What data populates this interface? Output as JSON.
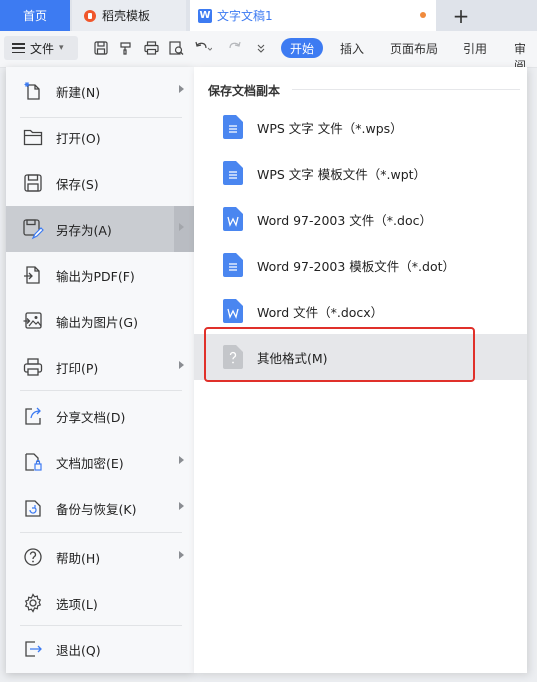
{
  "tabs": {
    "home": "首页",
    "templates": "稻壳模板",
    "document": "文字文稿1"
  },
  "toolbar": {
    "file_menu_label": "文件",
    "ribbon_tabs": [
      "开始",
      "插入",
      "页面布局",
      "引用",
      "审阅"
    ]
  },
  "file_menu": {
    "items": [
      {
        "label": "新建(N)",
        "icon": "new-document-icon",
        "has_submenu": true
      },
      {
        "label": "打开(O)",
        "icon": "folder-open-icon",
        "has_submenu": false
      },
      {
        "label": "保存(S)",
        "icon": "save-icon",
        "has_submenu": false
      },
      {
        "label": "另存为(A)",
        "icon": "save-as-icon",
        "has_submenu": true,
        "selected": true
      },
      {
        "label": "输出为PDF(F)",
        "icon": "export-pdf-icon",
        "has_submenu": false
      },
      {
        "label": "输出为图片(G)",
        "icon": "export-image-icon",
        "has_submenu": false
      },
      {
        "label": "打印(P)",
        "icon": "printer-icon",
        "has_submenu": true
      },
      {
        "label": "分享文档(D)",
        "icon": "share-icon",
        "has_submenu": false
      },
      {
        "label": "文档加密(E)",
        "icon": "encrypt-document-icon",
        "has_submenu": true
      },
      {
        "label": "备份与恢复(K)",
        "icon": "backup-restore-icon",
        "has_submenu": true
      },
      {
        "label": "帮助(H)",
        "icon": "help-icon",
        "has_submenu": true
      },
      {
        "label": "选项(L)",
        "icon": "gear-icon",
        "has_submenu": false
      },
      {
        "label": "退出(Q)",
        "icon": "exit-icon",
        "has_submenu": false
      }
    ]
  },
  "save_as_submenu": {
    "header": "保存文档副本",
    "items": [
      {
        "label": "WPS 文字 文件（*.wps）",
        "icon": "wps-file-icon"
      },
      {
        "label": "WPS 文字 模板文件（*.wpt）",
        "icon": "wps-template-icon"
      },
      {
        "label": "Word 97-2003 文件（*.doc）",
        "icon": "word-doc-icon"
      },
      {
        "label": "Word 97-2003 模板文件（*.dot）",
        "icon": "word-template-icon"
      },
      {
        "label": "Word 文件（*.docx）",
        "icon": "word-docx-icon"
      },
      {
        "label": "其他格式(M)",
        "icon": "other-format-icon",
        "selected": true
      }
    ]
  },
  "colors": {
    "accent": "#3d7bf2",
    "highlight_border": "#e0302a",
    "file_icon_blue": "#4a86f0",
    "file_icon_gray": "#c4c6ca"
  }
}
